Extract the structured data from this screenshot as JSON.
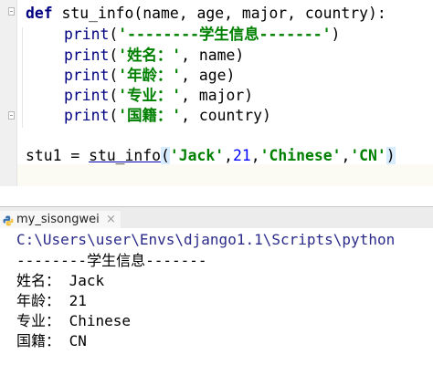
{
  "editor": {
    "line_def": {
      "keyword": "def",
      "signature": " stu_info(name, age, major, country):"
    },
    "print_lines": [
      {
        "func": "print",
        "open": "(",
        "string": "'--------学生信息-------'",
        "rest": ")"
      },
      {
        "func": "print",
        "open": "(",
        "string": "'姓名：'",
        "rest": ", name)"
      },
      {
        "func": "print",
        "open": "(",
        "string": "'年龄：'",
        "rest": ", age)"
      },
      {
        "func": "print",
        "open": "(",
        "string": "'专业：'",
        "rest": ", major)"
      },
      {
        "func": "print",
        "open": "(",
        "string": "'国籍：'",
        "rest": ", country)"
      }
    ],
    "call_line": {
      "target": "stu1 = ",
      "func": "stu_info",
      "open_paren": "(",
      "arg1": "'Jack'",
      "comma1": ",",
      "arg2": "21",
      "comma2": ",",
      "arg3": "'Chinese'",
      "comma3": ",",
      "arg4": "'CN'",
      "close_paren": ")"
    }
  },
  "run_panel": {
    "tab_label": "my_sisongwei",
    "tab_icon": "python-icon",
    "close_label": "×",
    "console_lines": [
      "C:\\Users\\user\\Envs\\django1.1\\Scripts\\python",
      "--------学生信息-------",
      "姓名： Jack",
      "年龄： 21",
      "专业： Chinese",
      "国籍： CN"
    ]
  }
}
